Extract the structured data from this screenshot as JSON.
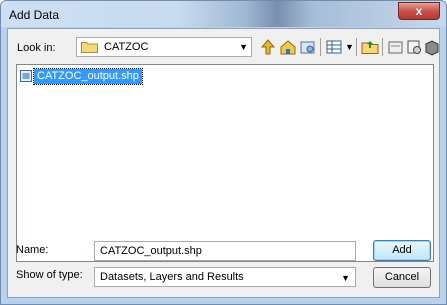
{
  "window": {
    "title": "Add Data",
    "close_symbol": "x"
  },
  "lookin": {
    "label": "Look in:",
    "value": "CATZOC"
  },
  "toolbar": {
    "buttons": [
      "go-to-parent-icon",
      "home-icon",
      "toggle-contents-icon",
      "view-menu-icon",
      "connect-folder-icon",
      "new-folder-icon",
      "catalog-icon",
      "toolbox-icon"
    ]
  },
  "files": [
    {
      "name": "CATZOC_output.shp",
      "selected": true
    }
  ],
  "name_field": {
    "label": "Name:",
    "value": "CATZOC_output.shp"
  },
  "type_field": {
    "label": "Show of type:",
    "value": "Datasets, Layers and Results"
  },
  "buttons": {
    "add": "Add",
    "cancel": "Cancel"
  },
  "colors": {
    "selection": "#3399ff",
    "dialog_bg": "#f0f0f0",
    "title_bar": "#c9dbee"
  }
}
